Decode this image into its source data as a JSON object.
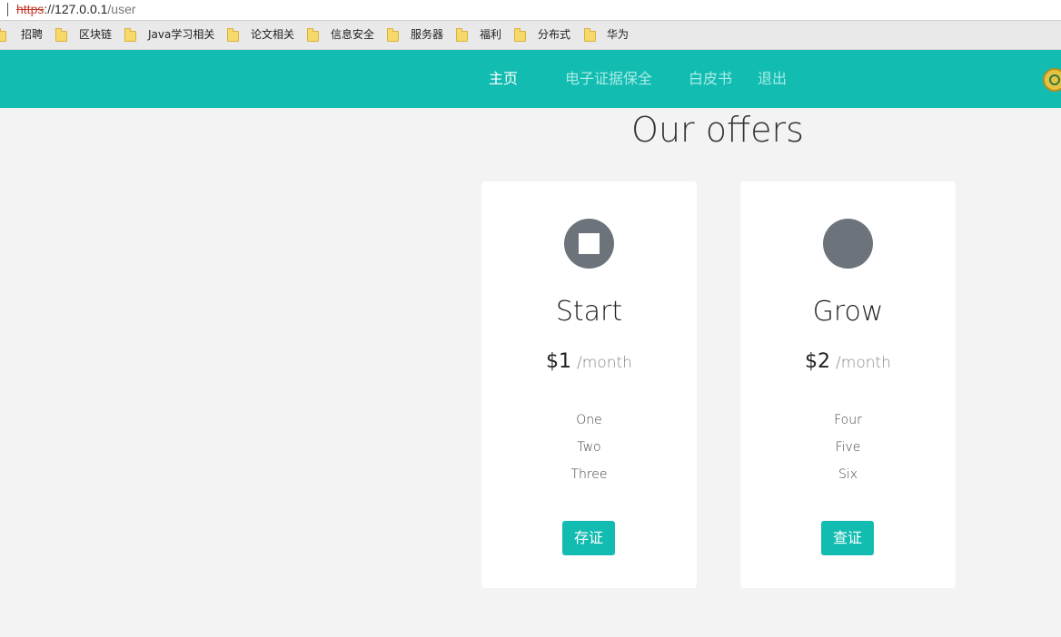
{
  "address_bar": {
    "scheme": "https",
    "separator": "://",
    "host": "127.0.0.1",
    "path": "/user"
  },
  "bookmarks": [
    "招聘",
    "区块链",
    "Java学习相关",
    "论文相关",
    "信息安全",
    "服务器",
    "福利",
    "分布式",
    "华为"
  ],
  "nav": {
    "items": [
      {
        "label": "主页",
        "active": true
      },
      {
        "label": "电子证据保全",
        "active": false
      },
      {
        "label": "白皮书",
        "active": false
      },
      {
        "label": "退出",
        "active": false
      }
    ],
    "accent_color": "#13bcb1"
  },
  "main": {
    "heading": "Our offers",
    "cards": [
      {
        "icon": "stop-icon",
        "title": "Start",
        "price": "$1",
        "period": "/month",
        "features": [
          "One",
          "Two",
          "Three"
        ],
        "button": "存证"
      },
      {
        "icon": "circle-icon",
        "title": "Grow",
        "price": "$2",
        "period": "/month",
        "features": [
          "Four",
          "Five",
          "Six"
        ],
        "button": "查证"
      }
    ]
  }
}
